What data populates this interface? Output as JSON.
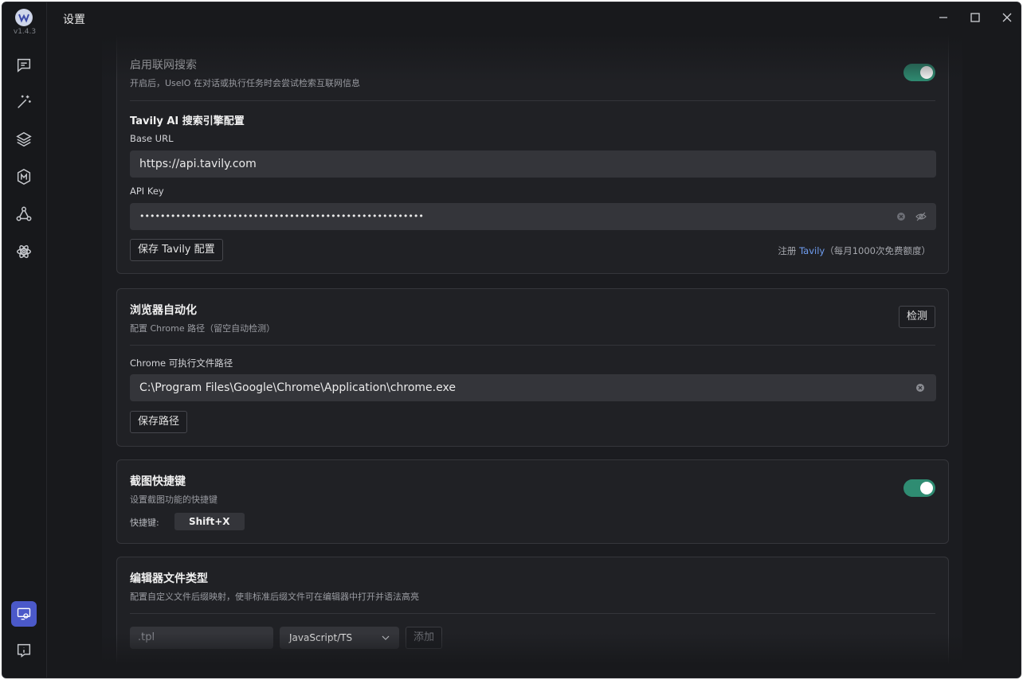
{
  "app": {
    "title": "设置",
    "version": "v1.4.3"
  },
  "sidebar": {
    "items": [
      {
        "icon": "chat-icon"
      },
      {
        "icon": "magic-wand-icon"
      },
      {
        "icon": "layers-icon"
      },
      {
        "icon": "model-icon"
      },
      {
        "icon": "network-icon"
      },
      {
        "icon": "atom-icon"
      }
    ],
    "bottom": [
      {
        "icon": "settings-screen-icon",
        "active": true
      },
      {
        "icon": "info-icon"
      }
    ]
  },
  "web_search": {
    "title": "启用联网搜索",
    "subtitle": "开启后，UseIO 在对话或执行任务时会尝试检索互联网信息",
    "enabled": true,
    "tavily_section_title": "Tavily AI 搜索引擎配置",
    "base_url_label": "Base URL",
    "base_url_value": "https://api.tavily.com",
    "api_key_label": "API Key",
    "api_key_value": "•••••••••••••••••••••••••••••••••••••••••••••••••••••••",
    "save_button": "保存 Tavily 配置",
    "hint_prefix": "注册 ",
    "hint_link": "Tavily",
    "hint_suffix": "（每月1000次免费额度）"
  },
  "browser": {
    "title": "浏览器自动化",
    "subtitle": "配置 Chrome 路径（留空自动检测）",
    "detect_button": "检测",
    "path_label": "Chrome 可执行文件路径",
    "path_value": "C:\\Program Files\\Google\\Chrome\\Application\\chrome.exe",
    "save_button": "保存路径"
  },
  "screenshot": {
    "title": "截图快捷键",
    "subtitle": "设置截图功能的快捷键",
    "enabled": true,
    "shortcut_label": "快捷键:",
    "shortcut_value": "Shift+X"
  },
  "editor_types": {
    "title": "编辑器文件类型",
    "subtitle": "配置自定义文件后缀映射，使非标准后缀文件可在编辑器中打开并语法高亮",
    "extension_placeholder": ".tpl",
    "language_selected": "JavaScript/TS",
    "add_button": "添加"
  },
  "colors": {
    "accent": "#4b59c9",
    "toggle_on": "#2f8c72",
    "link": "#6f9df0"
  }
}
